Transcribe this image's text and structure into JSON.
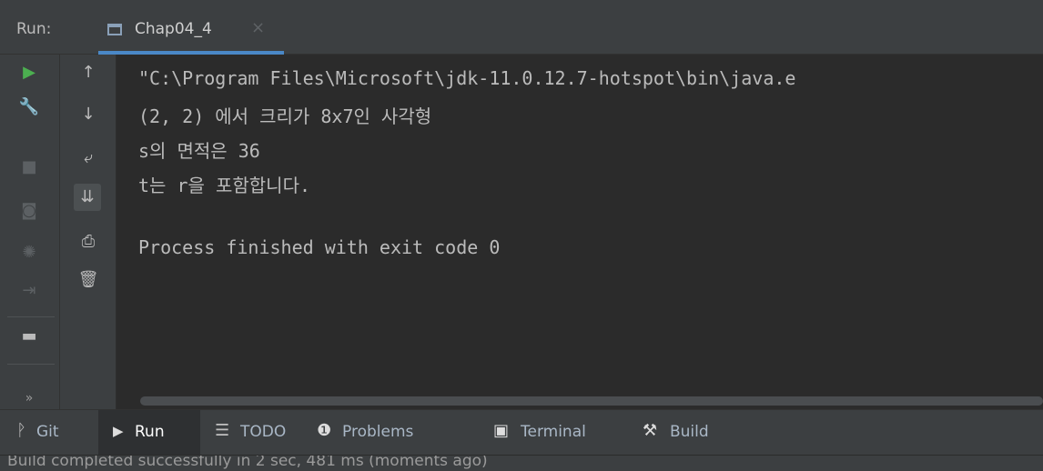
{
  "run_panel": {
    "label": "Run:",
    "tab": {
      "title": "Chap04_4",
      "close": "×"
    }
  },
  "console": {
    "lines": [
      "\"C:\\Program Files\\Microsoft\\jdk-11.0.12.7-hotspot\\bin\\java.e",
      "(2, 2) 에서 크리가 8x7인 사각형",
      "s의 면적은 36",
      "t는 r을 포함합니다.",
      "",
      "Process finished with exit code 0"
    ]
  },
  "left_toolbar": [
    {
      "name": "run-icon",
      "glyph": "▶",
      "color": "#4caf50"
    },
    {
      "name": "wrench-icon",
      "glyph": "🔧",
      "color": "#bbbbbb"
    },
    {
      "name": "stop-icon",
      "glyph": "■",
      "color": "#5c6063"
    },
    {
      "name": "camera-icon",
      "glyph": "◙",
      "color": "#5c6063"
    },
    {
      "name": "debug-icon",
      "glyph": "✺",
      "color": "#5c6063"
    },
    {
      "name": "exit-icon",
      "glyph": "⇥",
      "color": "#5c6063"
    },
    {
      "name": "layout-icon",
      "glyph": "▬",
      "color": "#bbbbbb"
    },
    {
      "name": "more-icon",
      "glyph": "»",
      "color": "#9a9a9a"
    }
  ],
  "console_actions": [
    {
      "name": "up-arrow-icon",
      "glyph": "↑"
    },
    {
      "name": "down-arrow-icon",
      "glyph": "↓"
    },
    {
      "name": "soft-wrap-icon",
      "glyph": "⤶"
    },
    {
      "name": "scroll-to-end-icon",
      "glyph": "⇊"
    },
    {
      "name": "print-icon",
      "glyph": "⎙"
    },
    {
      "name": "trash-icon",
      "glyph": "🗑"
    }
  ],
  "tool_windows": [
    {
      "label": "Git",
      "icon": "ᚹ",
      "icon_name": "git-icon"
    },
    {
      "label": "Run",
      "icon": "▶",
      "icon_name": "run-tool-icon",
      "active": true
    },
    {
      "label": "TODO",
      "icon": "☰",
      "icon_name": "todo-icon"
    },
    {
      "label": "Problems",
      "icon": "❶",
      "icon_name": "problems-icon"
    },
    {
      "label": "Terminal",
      "icon": "▣",
      "icon_name": "terminal-icon"
    },
    {
      "label": "Build",
      "icon": "⚒",
      "icon_name": "build-icon"
    }
  ],
  "status_bar": {
    "message": "Build completed successfully in 2 sec, 481 ms (moments ago)"
  },
  "colors": {
    "panel": "#3c3f41",
    "console_bg": "#2b2b2b",
    "accent": "#4a88c7",
    "run_green": "#4caf50"
  }
}
